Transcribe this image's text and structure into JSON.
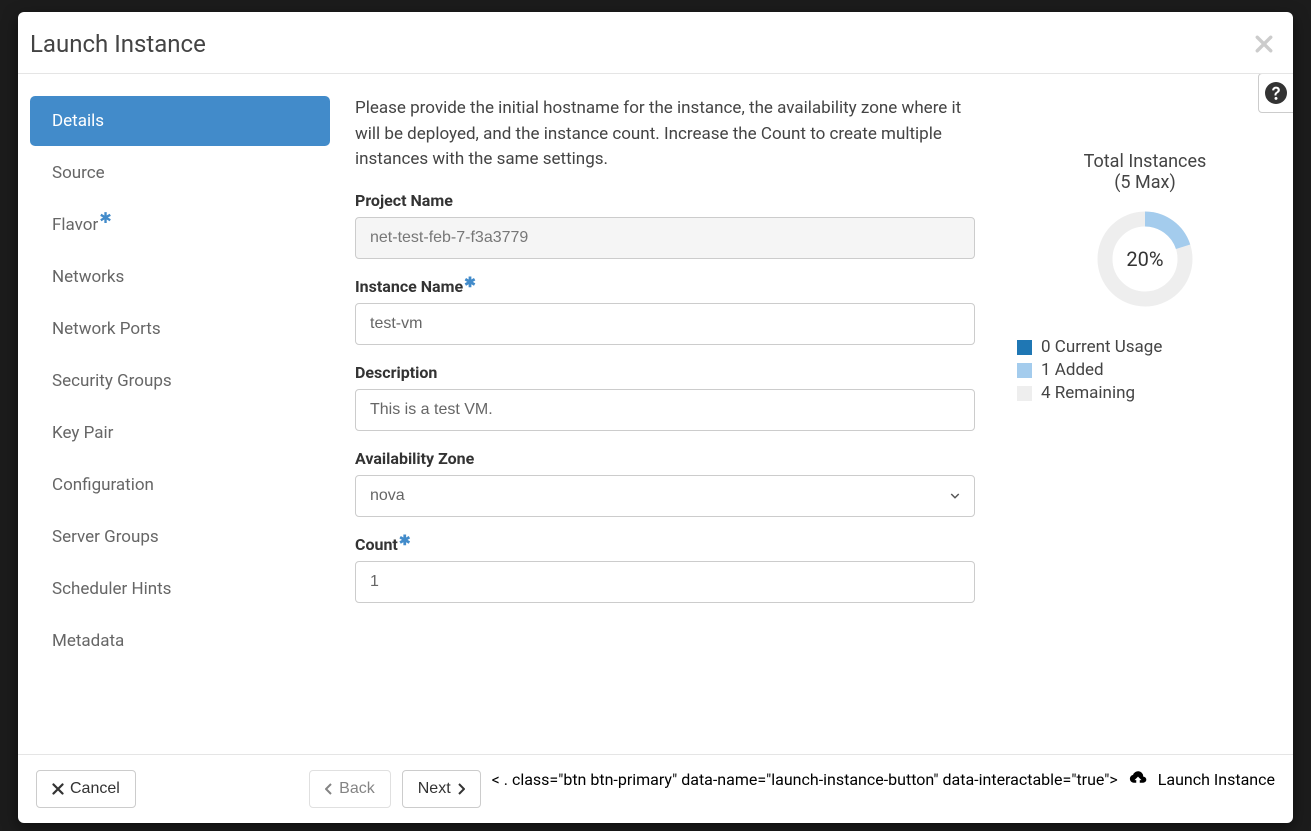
{
  "modal": {
    "title": "Launch Instance"
  },
  "nav": {
    "items": [
      {
        "label": "Details",
        "required": false,
        "active": true
      },
      {
        "label": "Source",
        "required": false,
        "active": false
      },
      {
        "label": "Flavor",
        "required": true,
        "active": false
      },
      {
        "label": "Networks",
        "required": false,
        "active": false
      },
      {
        "label": "Network Ports",
        "required": false,
        "active": false
      },
      {
        "label": "Security Groups",
        "required": false,
        "active": false
      },
      {
        "label": "Key Pair",
        "required": false,
        "active": false
      },
      {
        "label": "Configuration",
        "required": false,
        "active": false
      },
      {
        "label": "Server Groups",
        "required": false,
        "active": false
      },
      {
        "label": "Scheduler Hints",
        "required": false,
        "active": false
      },
      {
        "label": "Metadata",
        "required": false,
        "active": false
      }
    ]
  },
  "details": {
    "intro": "Please provide the initial hostname for the instance, the availability zone where it will be deployed, and the instance count. Increase the Count to create multiple instances with the same settings.",
    "project_name_label": "Project Name",
    "project_name_value": "net-test-feb-7-f3a3779",
    "instance_name_label": "Instance Name",
    "instance_name_value": "test-vm",
    "description_label": "Description",
    "description_value": "This is a test VM.",
    "availability_zone_label": "Availability Zone",
    "availability_zone_value": "nova",
    "count_label": "Count",
    "count_value": "1"
  },
  "summary": {
    "title": "Total Instances",
    "max": "(5 Max)",
    "percent": "20%",
    "legend": [
      {
        "swatch": "sw-dark",
        "value": "0",
        "label": "Current Usage"
      },
      {
        "swatch": "sw-light",
        "value": "1",
        "label": "Added"
      },
      {
        "swatch": "sw-grey",
        "value": "4",
        "label": "Remaining"
      }
    ]
  },
  "footer": {
    "cancel": "Cancel",
    "back": "Back",
    "next": "Next",
    "launch": "Launch Instance"
  },
  "chart_data": {
    "type": "pie",
    "title": "Total Instances (5 Max)",
    "categories": [
      "Current Usage",
      "Added",
      "Remaining"
    ],
    "values": [
      0,
      1,
      4
    ],
    "percent_label": "20%"
  }
}
